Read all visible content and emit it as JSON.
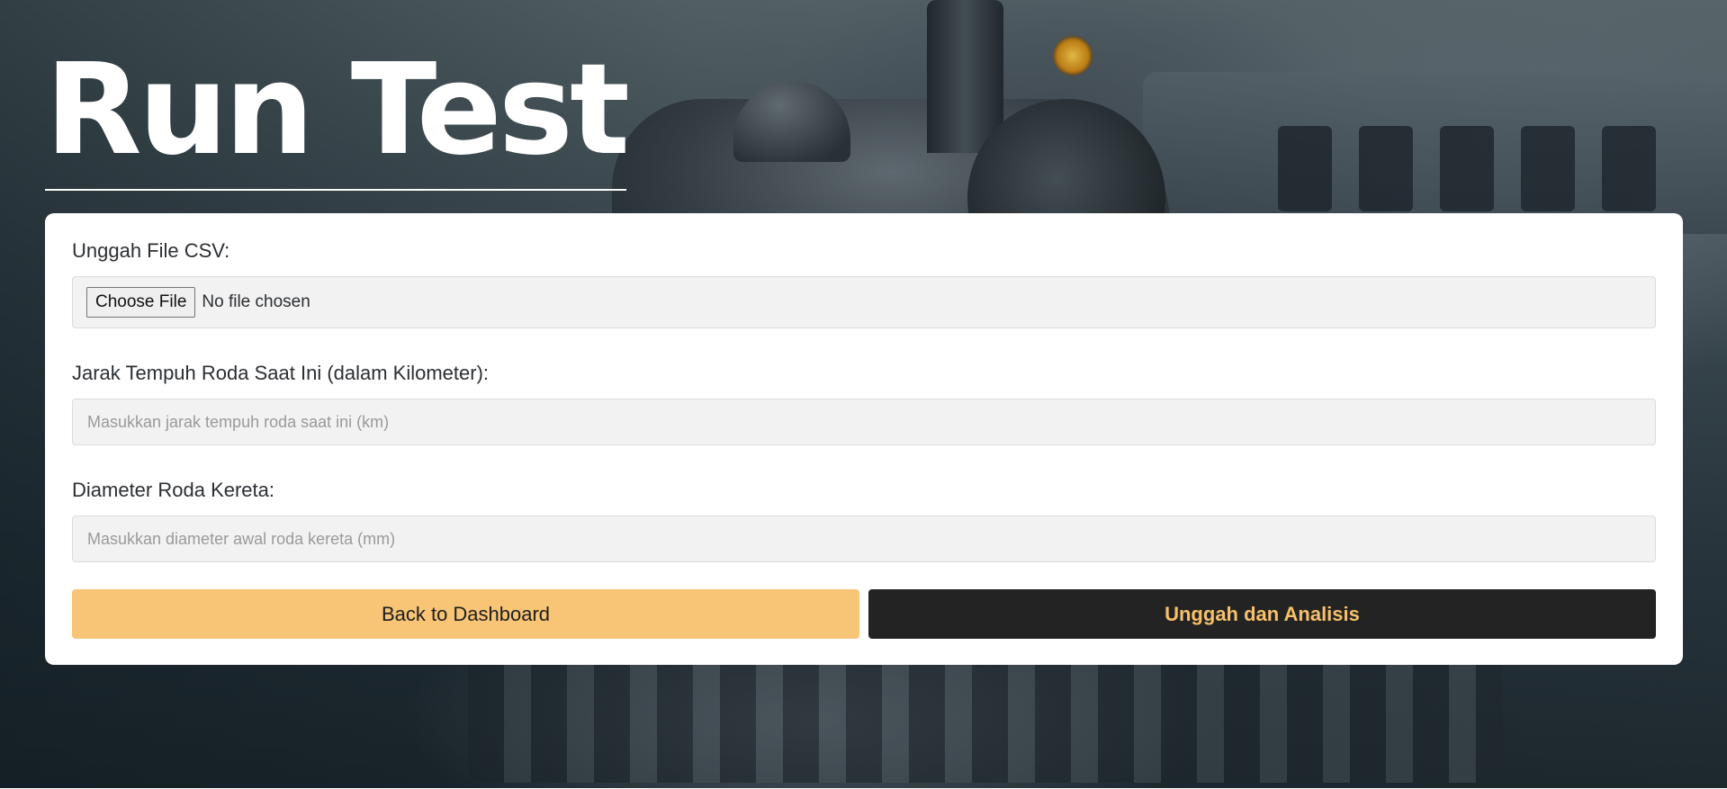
{
  "page": {
    "title": "Run Test"
  },
  "form": {
    "csv_label": "Unggah File CSV:",
    "file_button": "Choose File",
    "file_status": "No file chosen",
    "distance_label": "Jarak Tempuh Roda Saat Ini (dalam Kilometer):",
    "distance_placeholder": "Masukkan jarak tempuh roda saat ini (km)",
    "distance_value": "",
    "diameter_label": "Diameter Roda Kereta:",
    "diameter_placeholder": "Masukkan diameter awal roda kereta (mm)",
    "diameter_value": ""
  },
  "actions": {
    "back_label": "Back to Dashboard",
    "submit_label": "Unggah dan Analisis"
  },
  "colors": {
    "back_button": "#f8c476",
    "submit_button": "#232323",
    "submit_text": "#f7c06a"
  },
  "background": {
    "image": "steam-locomotive-photo"
  }
}
